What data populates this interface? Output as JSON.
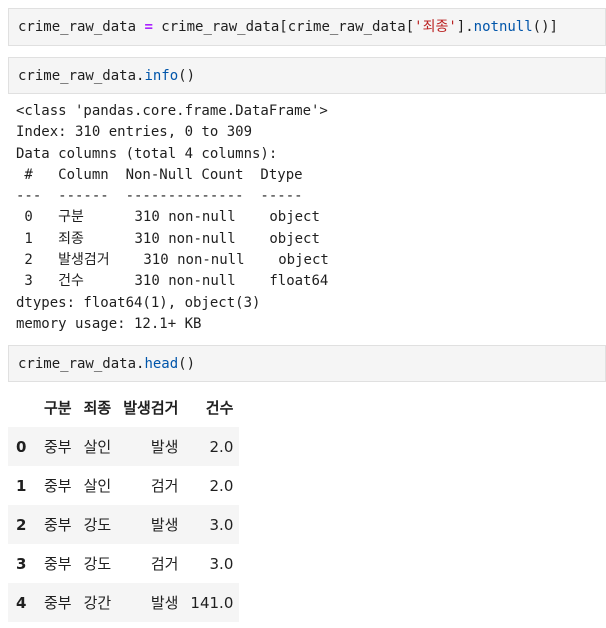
{
  "cell1": {
    "prefix": "crime_raw_data ",
    "op": "=",
    "mid": " crime_raw_data[crime_raw_data[",
    "str": "'죄종'",
    "close": "].",
    "method": "notnull",
    "end": "()]"
  },
  "cell2": {
    "prefix": "crime_raw_data.",
    "method": "info",
    "end": "()"
  },
  "output_lines": [
    "<class 'pandas.core.frame.DataFrame'>",
    "Index: 310 entries, 0 to 309",
    "Data columns (total 4 columns):",
    " #   Column  Non-Null Count  Dtype",
    "---  ------  --------------  -----",
    " 0   구분      310 non-null    object",
    " 1   죄종      310 non-null    object",
    " 2   발생검거    310 non-null    object",
    " 3   건수      310 non-null    float64",
    "dtypes: float64(1), object(3)",
    "memory usage: 12.1+ KB"
  ],
  "cell3": {
    "prefix": "crime_raw_data.",
    "method": "head",
    "end": "()"
  },
  "table": {
    "columns": [
      "",
      "구분",
      "죄종",
      "발생검거",
      "건수"
    ],
    "rows": [
      [
        "0",
        "중부",
        "살인",
        "발생",
        "2.0"
      ],
      [
        "1",
        "중부",
        "살인",
        "검거",
        "2.0"
      ],
      [
        "2",
        "중부",
        "강도",
        "발생",
        "3.0"
      ],
      [
        "3",
        "중부",
        "강도",
        "검거",
        "3.0"
      ],
      [
        "4",
        "중부",
        "강간",
        "발생",
        "141.0"
      ]
    ]
  }
}
